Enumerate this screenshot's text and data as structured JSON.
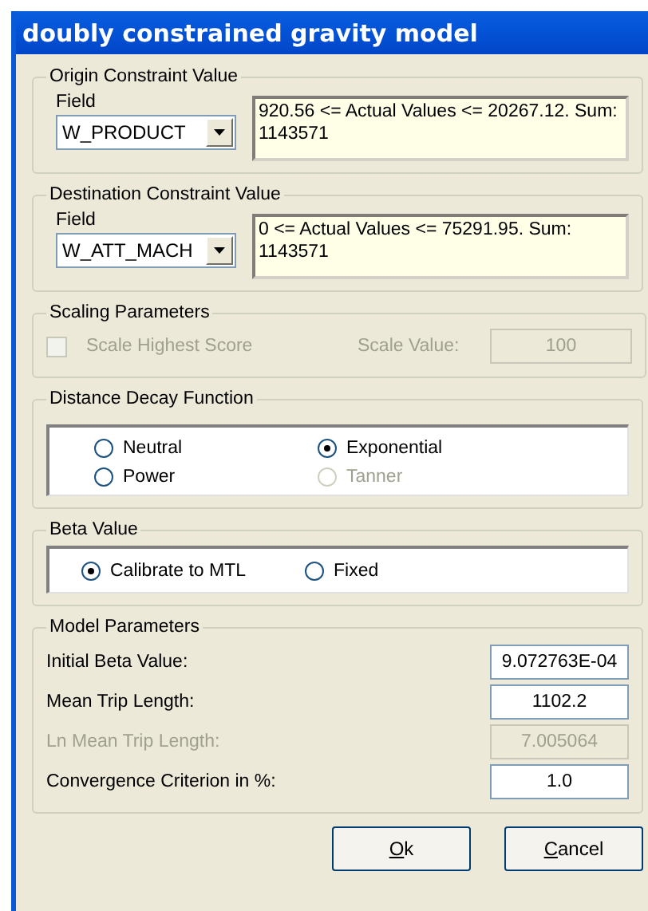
{
  "window": {
    "title": "doubly constrained gravity model"
  },
  "origin": {
    "title": "Origin Constraint Value",
    "field_label": "Field",
    "field_value": "W_PRODUCT",
    "summary": "920.56 <= Actual Values <=  20267.12. Sum: 1143571"
  },
  "destination": {
    "title": "Destination Constraint Value",
    "field_label": "Field",
    "field_value": "W_ATT_MACH",
    "summary": "0 <= Actual Values <=  75291.95. Sum: 1143571"
  },
  "scaling": {
    "title": "Scaling Parameters",
    "checkbox": {
      "label": "Scale Highest Score",
      "checked": false,
      "disabled": true
    },
    "value_label": "Scale Value:",
    "value": "100",
    "value_disabled": true
  },
  "distance_decay": {
    "title": "Distance Decay Function",
    "options": [
      {
        "label": "Neutral",
        "selected": false,
        "disabled": false
      },
      {
        "label": "Exponential",
        "selected": true,
        "disabled": false
      },
      {
        "label": "Power",
        "selected": false,
        "disabled": false
      },
      {
        "label": "Tanner",
        "selected": false,
        "disabled": true
      }
    ]
  },
  "beta": {
    "title": "Beta Value",
    "options": [
      {
        "label": "Calibrate to MTL",
        "selected": true,
        "disabled": false
      },
      {
        "label": "Fixed",
        "selected": false,
        "disabled": false
      }
    ]
  },
  "model_parameters": {
    "title": "Model Parameters",
    "rows": [
      {
        "label": "Initial Beta Value:",
        "value": "9.072763E-04",
        "disabled": false
      },
      {
        "label": "Mean Trip Length:",
        "value": "1102.2",
        "disabled": false
      },
      {
        "label": "Ln Mean Trip Length:",
        "value": "7.005064",
        "disabled": true
      },
      {
        "label": "Convergence Criterion in %:",
        "value": "1.0",
        "disabled": false
      }
    ]
  },
  "buttons": [
    "Ok",
    "Cancel"
  ]
}
